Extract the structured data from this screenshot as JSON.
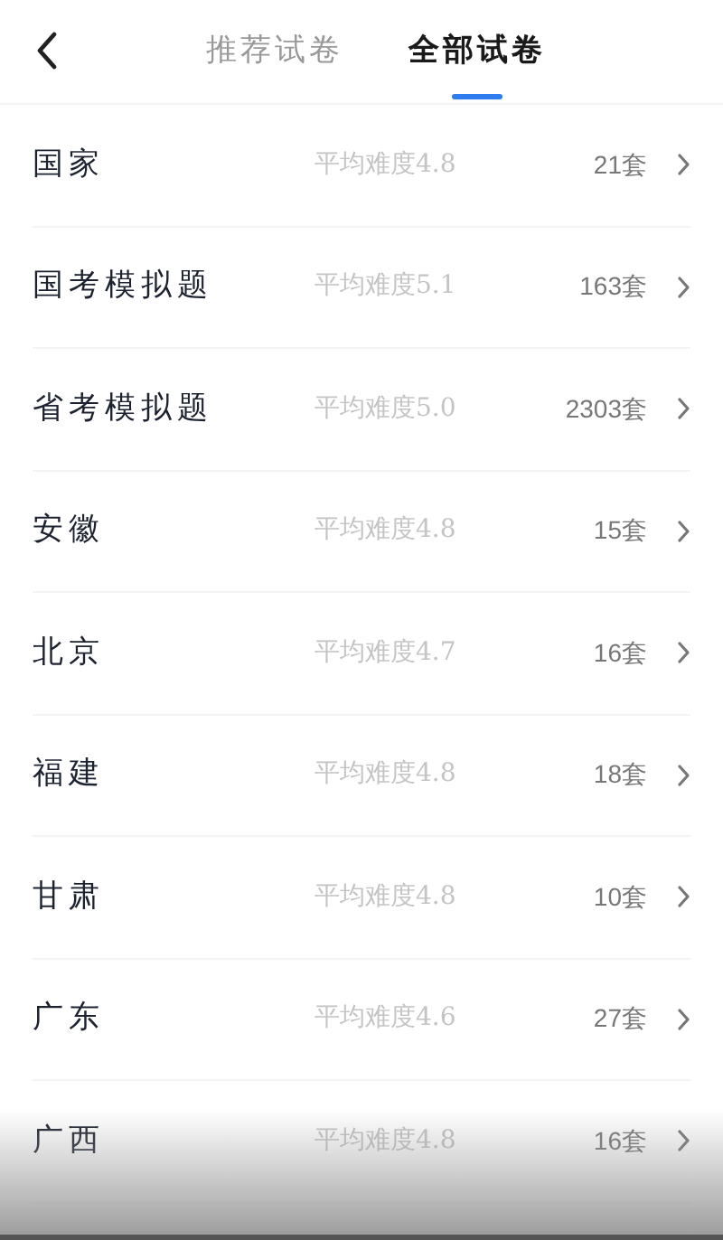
{
  "header": {
    "tabs": [
      {
        "label": "推荐试卷",
        "selected": false
      },
      {
        "label": "全部试卷",
        "selected": true
      }
    ]
  },
  "rows": [
    {
      "name": "国家",
      "difficulty": "平均难度4.8",
      "count": "21套"
    },
    {
      "name": "国考模拟题",
      "difficulty": "平均难度5.1",
      "count": "163套"
    },
    {
      "name": "省考模拟题",
      "difficulty": "平均难度5.0",
      "count": "2303套"
    },
    {
      "name": "安徽",
      "difficulty": "平均难度4.8",
      "count": "15套"
    },
    {
      "name": "北京",
      "difficulty": "平均难度4.7",
      "count": "16套"
    },
    {
      "name": "福建",
      "difficulty": "平均难度4.8",
      "count": "18套"
    },
    {
      "name": "甘肃",
      "difficulty": "平均难度4.8",
      "count": "10套"
    },
    {
      "name": "广东",
      "difficulty": "平均难度4.6",
      "count": "27套"
    },
    {
      "name": "广西",
      "difficulty": "平均难度4.8",
      "count": "16套"
    }
  ]
}
